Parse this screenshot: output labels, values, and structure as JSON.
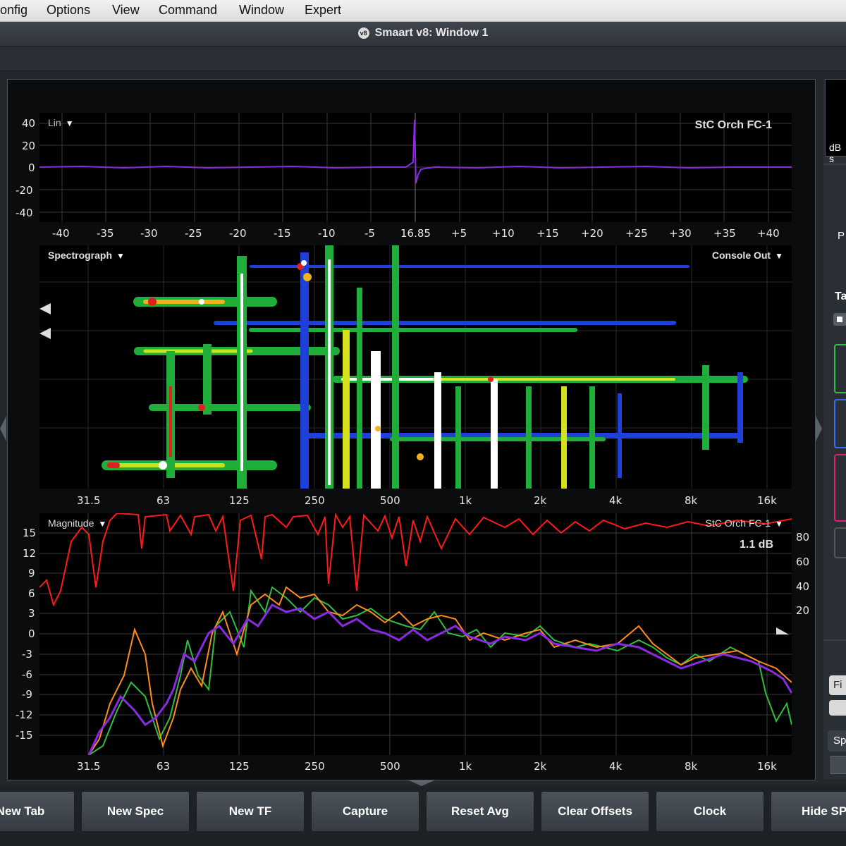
{
  "menu": [
    "onfig",
    "Options",
    "View",
    "Command",
    "Window",
    "Expert"
  ],
  "window": {
    "title": "Smaart v8:  Window 1",
    "icon_text": "v8"
  },
  "impulse": {
    "mode_label": "Lin",
    "trace_name": "StC Orch FC-1",
    "y_ticks": [
      "40",
      "20",
      "0",
      "-20",
      "-40"
    ],
    "x_ticks": [
      "-40",
      "-35",
      "-30",
      "-25",
      "-20",
      "-15",
      "-10",
      "-5",
      "16.85",
      "+5",
      "+10",
      "+15",
      "+20",
      "+25",
      "+30",
      "+35",
      "+40"
    ],
    "color": "#8a2be2"
  },
  "spectrograph": {
    "label": "Spectrograph",
    "source": "Console Out",
    "x_ticks": [
      "31.5",
      "63",
      "125",
      "250",
      "500",
      "1k",
      "2k",
      "4k",
      "8k",
      "16k"
    ]
  },
  "magnitude": {
    "label": "Magnitude",
    "trace_name": "StC Orch FC-1",
    "readout": "1.1 dB",
    "y_ticks_left": [
      "15",
      "12",
      "9",
      "6",
      "3",
      "0",
      "-3",
      "-6",
      "-9",
      "-12",
      "-15"
    ],
    "y_ticks_right": [
      "80",
      "60",
      "40",
      "20"
    ],
    "x_ticks": [
      "31.5",
      "63",
      "125",
      "250",
      "500",
      "1k",
      "2k",
      "4k",
      "8k",
      "16k"
    ],
    "colors": {
      "coherence": "#ff1a1a",
      "trace_purple": "#8a2be2",
      "trace_orange": "#ff8c1a",
      "trace_green": "#2fbf3f"
    }
  },
  "right_panel": {
    "db_label": "dB s",
    "p_label": "P",
    "ta_label": "Ta",
    "fi_label": "Fi",
    "sp_label": "Sp"
  },
  "buttons": [
    "New Tab",
    "New Spec",
    "New TF",
    "Capture",
    "Reset Avg",
    "Clear Offsets",
    "Clock",
    "Hide SPL"
  ]
}
